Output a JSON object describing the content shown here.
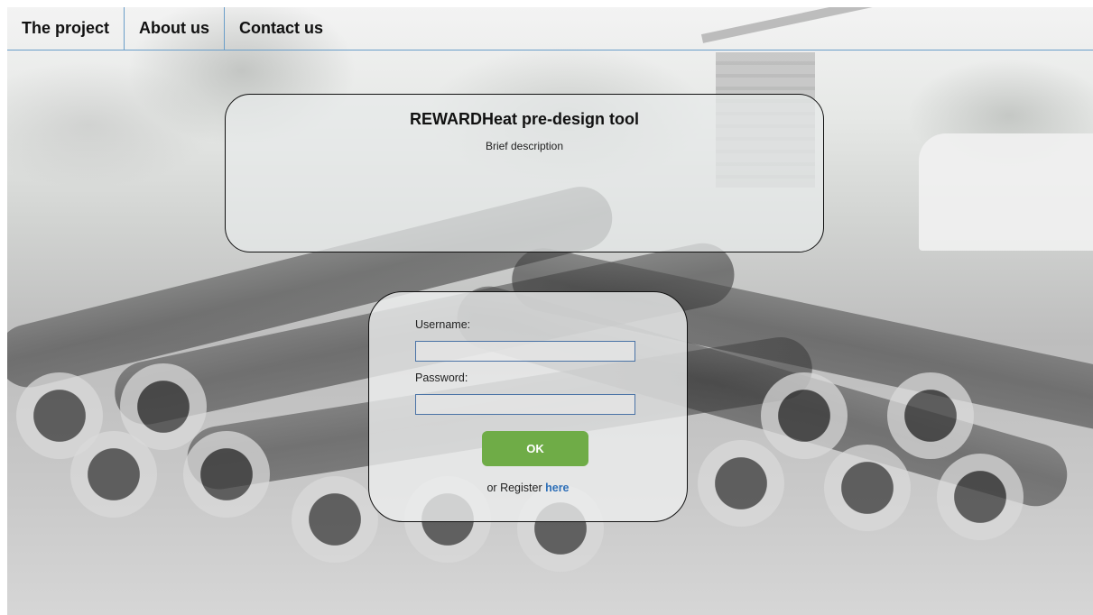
{
  "nav": {
    "items": [
      {
        "label": "The project"
      },
      {
        "label": "About us"
      },
      {
        "label": "Contact us"
      }
    ]
  },
  "info": {
    "title": "REWARDHeat pre-design tool",
    "description": "Brief description"
  },
  "login": {
    "username_label": "Username:",
    "username_value": "",
    "password_label": "Password:",
    "password_value": "",
    "ok_label": "OK",
    "register_prefix": "or Register",
    "register_link": "here"
  },
  "colors": {
    "nav_border": "#6a9ec9",
    "input_border": "#4a73a6",
    "ok_button": "#6fac47",
    "link": "#2e6fb7"
  },
  "icons": {
    "background": "pipes-construction-photo"
  }
}
